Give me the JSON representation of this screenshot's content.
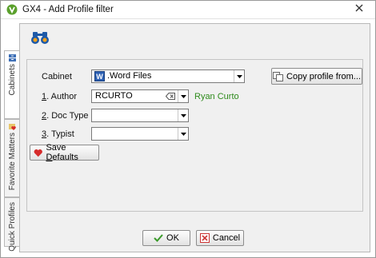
{
  "window": {
    "title": "GX4 - Add Profile filter"
  },
  "side_tabs": [
    {
      "label": "Cabinets",
      "icon": "cabinet-icon"
    },
    {
      "label": "Favorite Matters",
      "icon": "heart-folder-icon"
    },
    {
      "label": "Quick Profiles",
      "icon": "clock-icon"
    }
  ],
  "form": {
    "cabinet_label": "Cabinet",
    "cabinet_value": ".Word Files",
    "author_label_num": "1",
    "author_label_text": ". Author",
    "author_value": "RCURTO",
    "author_name": "Ryan Curto",
    "doctype_label_num": "2",
    "doctype_label_text": ". Doc Type",
    "doctype_value": "",
    "typist_label_num": "3",
    "typist_label_text": ". Typist",
    "typist_value": ""
  },
  "buttons": {
    "copy_profile": "Copy profile from...",
    "save_defaults_pre": "Save ",
    "save_defaults_u": "D",
    "save_defaults_post": "efaults",
    "ok": "OK",
    "cancel": "Cancel"
  },
  "colors": {
    "accent_green": "#2e8b1c",
    "word_blue": "#2b5fb3"
  }
}
